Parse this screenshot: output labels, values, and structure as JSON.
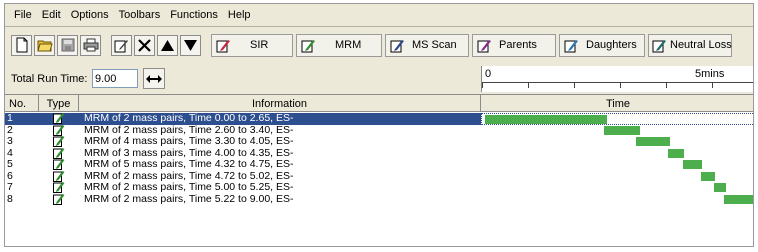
{
  "menu": [
    "File",
    "Edit",
    "Options",
    "Toolbars",
    "Functions",
    "Help"
  ],
  "toolbar": {
    "icons": [
      "new-file-icon",
      "open-folder-icon",
      "save-icon",
      "print-icon",
      "edit-icon",
      "delete-icon",
      "move-up-icon",
      "move-down-icon"
    ],
    "scan_buttons": [
      "SIR",
      "MRM",
      "MS Scan",
      "Parents",
      "Daughters",
      "Neutral Loss"
    ]
  },
  "run": {
    "label": "Total Run Time:",
    "value": "9.00",
    "ruler_start": "0",
    "ruler_mark": "5mins"
  },
  "table": {
    "headers": {
      "no": "No.",
      "type": "Type",
      "info": "Information",
      "time": "Time"
    },
    "rows": [
      {
        "no": "1",
        "info": "MRM of 2 mass pairs, Time 0.00 to 2.65, ES-",
        "start": 0.0,
        "end": 2.65,
        "selected": true
      },
      {
        "no": "2",
        "info": "MRM of 2 mass pairs, Time 2.60 to 3.40, ES-",
        "start": 2.6,
        "end": 3.4,
        "selected": false
      },
      {
        "no": "3",
        "info": "MRM of 4 mass pairs, Time 3.30 to 4.05, ES-",
        "start": 3.3,
        "end": 4.05,
        "selected": false
      },
      {
        "no": "4",
        "info": "MRM of 3 mass pairs, Time 4.00 to 4.35, ES-",
        "start": 4.0,
        "end": 4.35,
        "selected": false
      },
      {
        "no": "5",
        "info": "MRM of 5 mass pairs, Time 4.32 to 4.75, ES-",
        "start": 4.32,
        "end": 4.75,
        "selected": false
      },
      {
        "no": "6",
        "info": "MRM of 2 mass pairs, Time 4.72 to 5.02, ES-",
        "start": 4.72,
        "end": 5.02,
        "selected": false
      },
      {
        "no": "7",
        "info": "MRM of 2 mass pairs, Time 5.00 to 5.25, ES-",
        "start": 5.0,
        "end": 5.25,
        "selected": false
      },
      {
        "no": "8",
        "info": "MRM of 2 mass pairs, Time 5.22 to 9.00, ES-",
        "start": 5.22,
        "end": 9.0,
        "selected": false
      }
    ]
  },
  "colors": {
    "bar": "#4cae4c",
    "selection": "#2e4f8f",
    "type_icon": "#2f8f2f"
  }
}
